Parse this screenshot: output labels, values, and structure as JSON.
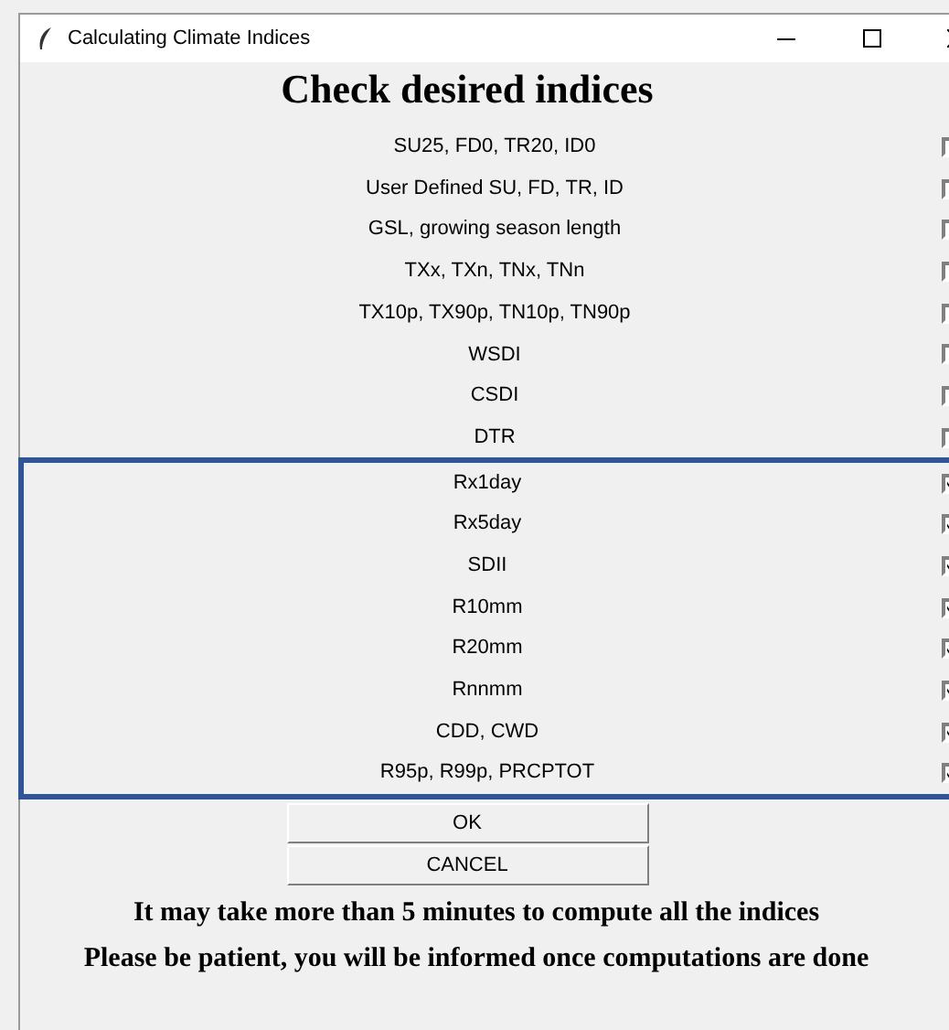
{
  "window": {
    "title": "Calculating Climate Indices"
  },
  "heading": "Check desired indices",
  "indices": [
    {
      "label": "SU25, FD0, TR20, ID0",
      "checked": false
    },
    {
      "label": "User Defined SU, FD, TR, ID",
      "checked": false
    },
    {
      "label": "GSL, growing season length",
      "checked": false
    },
    {
      "label": "TXx, TXn, TNx, TNn",
      "checked": false
    },
    {
      "label": "TX10p, TX90p, TN10p, TN90p",
      "checked": false
    },
    {
      "label": "WSDI",
      "checked": false
    },
    {
      "label": "CSDI",
      "checked": false
    },
    {
      "label": "DTR",
      "checked": false
    },
    {
      "label": "Rx1day",
      "checked": true
    },
    {
      "label": "Rx5day",
      "checked": true
    },
    {
      "label": "SDII",
      "checked": true
    },
    {
      "label": "R10mm",
      "checked": true
    },
    {
      "label": "R20mm",
      "checked": true
    },
    {
      "label": "Rnnmm",
      "checked": true
    },
    {
      "label": "CDD, CWD",
      "checked": true
    },
    {
      "label": "R95p, R99p, PRCPTOT",
      "checked": true
    }
  ],
  "buttons": [
    "OK",
    "CANCEL"
  ],
  "messages": [
    "It may take more than 5 minutes to compute all the indices",
    "Please be patient, you will be informed once computations are done"
  ]
}
